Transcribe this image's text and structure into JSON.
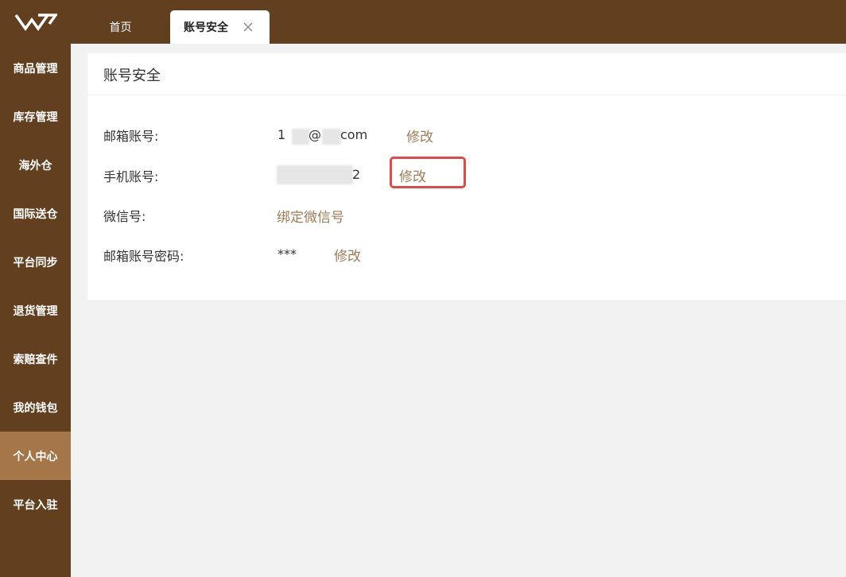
{
  "header": {
    "logo": "logo-icon",
    "tabs": [
      {
        "label": "首页"
      },
      {
        "label": "账号安全",
        "active": true
      }
    ]
  },
  "sidebar": {
    "items": [
      {
        "label": "商品管理"
      },
      {
        "label": "库存管理"
      },
      {
        "label": "海外仓"
      },
      {
        "label": "国际送仓"
      },
      {
        "label": "平台同步"
      },
      {
        "label": "退货管理"
      },
      {
        "label": "索赔查件"
      },
      {
        "label": "我的钱包"
      },
      {
        "label": "个人中心",
        "active": true
      },
      {
        "label": "平台入驻"
      }
    ]
  },
  "main": {
    "title": "账号安全",
    "rows": [
      {
        "label": "邮箱账号:",
        "value_start": "1",
        "value_at": "@",
        "value_end": "com",
        "action": "修改"
      },
      {
        "label": "手机账号:",
        "value_end": "2",
        "action": "修改"
      },
      {
        "label": "微信号:",
        "action": "绑定微信号"
      },
      {
        "label": "邮箱账号密码:",
        "value": "***",
        "action": "修改"
      }
    ]
  },
  "colors": {
    "brand": "#623f1e",
    "sidebar_active": "#a57648",
    "link": "#a07c56",
    "highlight": "#e14a49"
  }
}
